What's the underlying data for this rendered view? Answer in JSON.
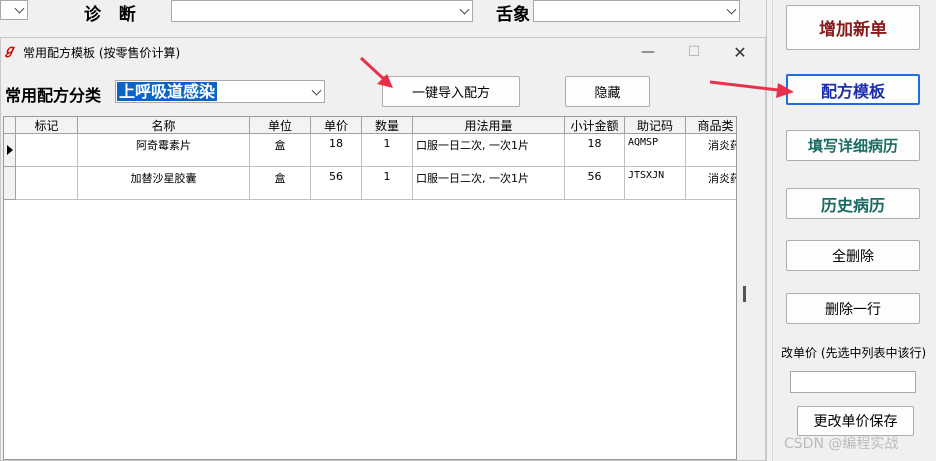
{
  "top": {
    "diagnosis_label": "诊   断",
    "tongue_label": "舌象"
  },
  "window": {
    "title": "常用配方模板 (按零售价计算)",
    "category_label": "常用配方分类",
    "category_value": "上呼吸道感染",
    "import_button": "一键导入配方",
    "hide_button": "隐藏",
    "minimize": "—",
    "maximize": "☐",
    "close": "✕"
  },
  "grid": {
    "columns": [
      "标记",
      "名称",
      "单位",
      "单价",
      "数量",
      "用法用量",
      "小计金额",
      "助记码",
      "商品类"
    ],
    "rows": [
      {
        "mark": "",
        "name": "阿奇霉素片",
        "unit": "盒",
        "price": "18",
        "qty": "1",
        "usage": "口服一日二次, 一次1片",
        "subtotal": "18",
        "code": "AQMSP",
        "category": "消炎药"
      },
      {
        "mark": "",
        "name": "加替沙星胶囊",
        "unit": "盒",
        "price": "56",
        "qty": "1",
        "usage": "口服一日二次, 一次1片",
        "subtotal": "56",
        "code": "JTSXJN",
        "category": "消炎药"
      }
    ]
  },
  "right_panel": {
    "add_order": "增加新单",
    "template": "配方模板",
    "fill_history": "填写详细病历",
    "history": "历史病历",
    "delete_all": "全删除",
    "delete_row": "删除一行",
    "price_label": "改单价 (先选中列表中该行)",
    "save_price": "更改单价保存"
  },
  "watermark": "CSDN @编程实战",
  "colors": {
    "add_order_text": "#8b1a1a",
    "template_text": "#1a2fb0",
    "template_border": "#1e6fd9",
    "green_text": "#1a6b62",
    "arrow": "#e8304a",
    "selection": "#0a64c8"
  }
}
